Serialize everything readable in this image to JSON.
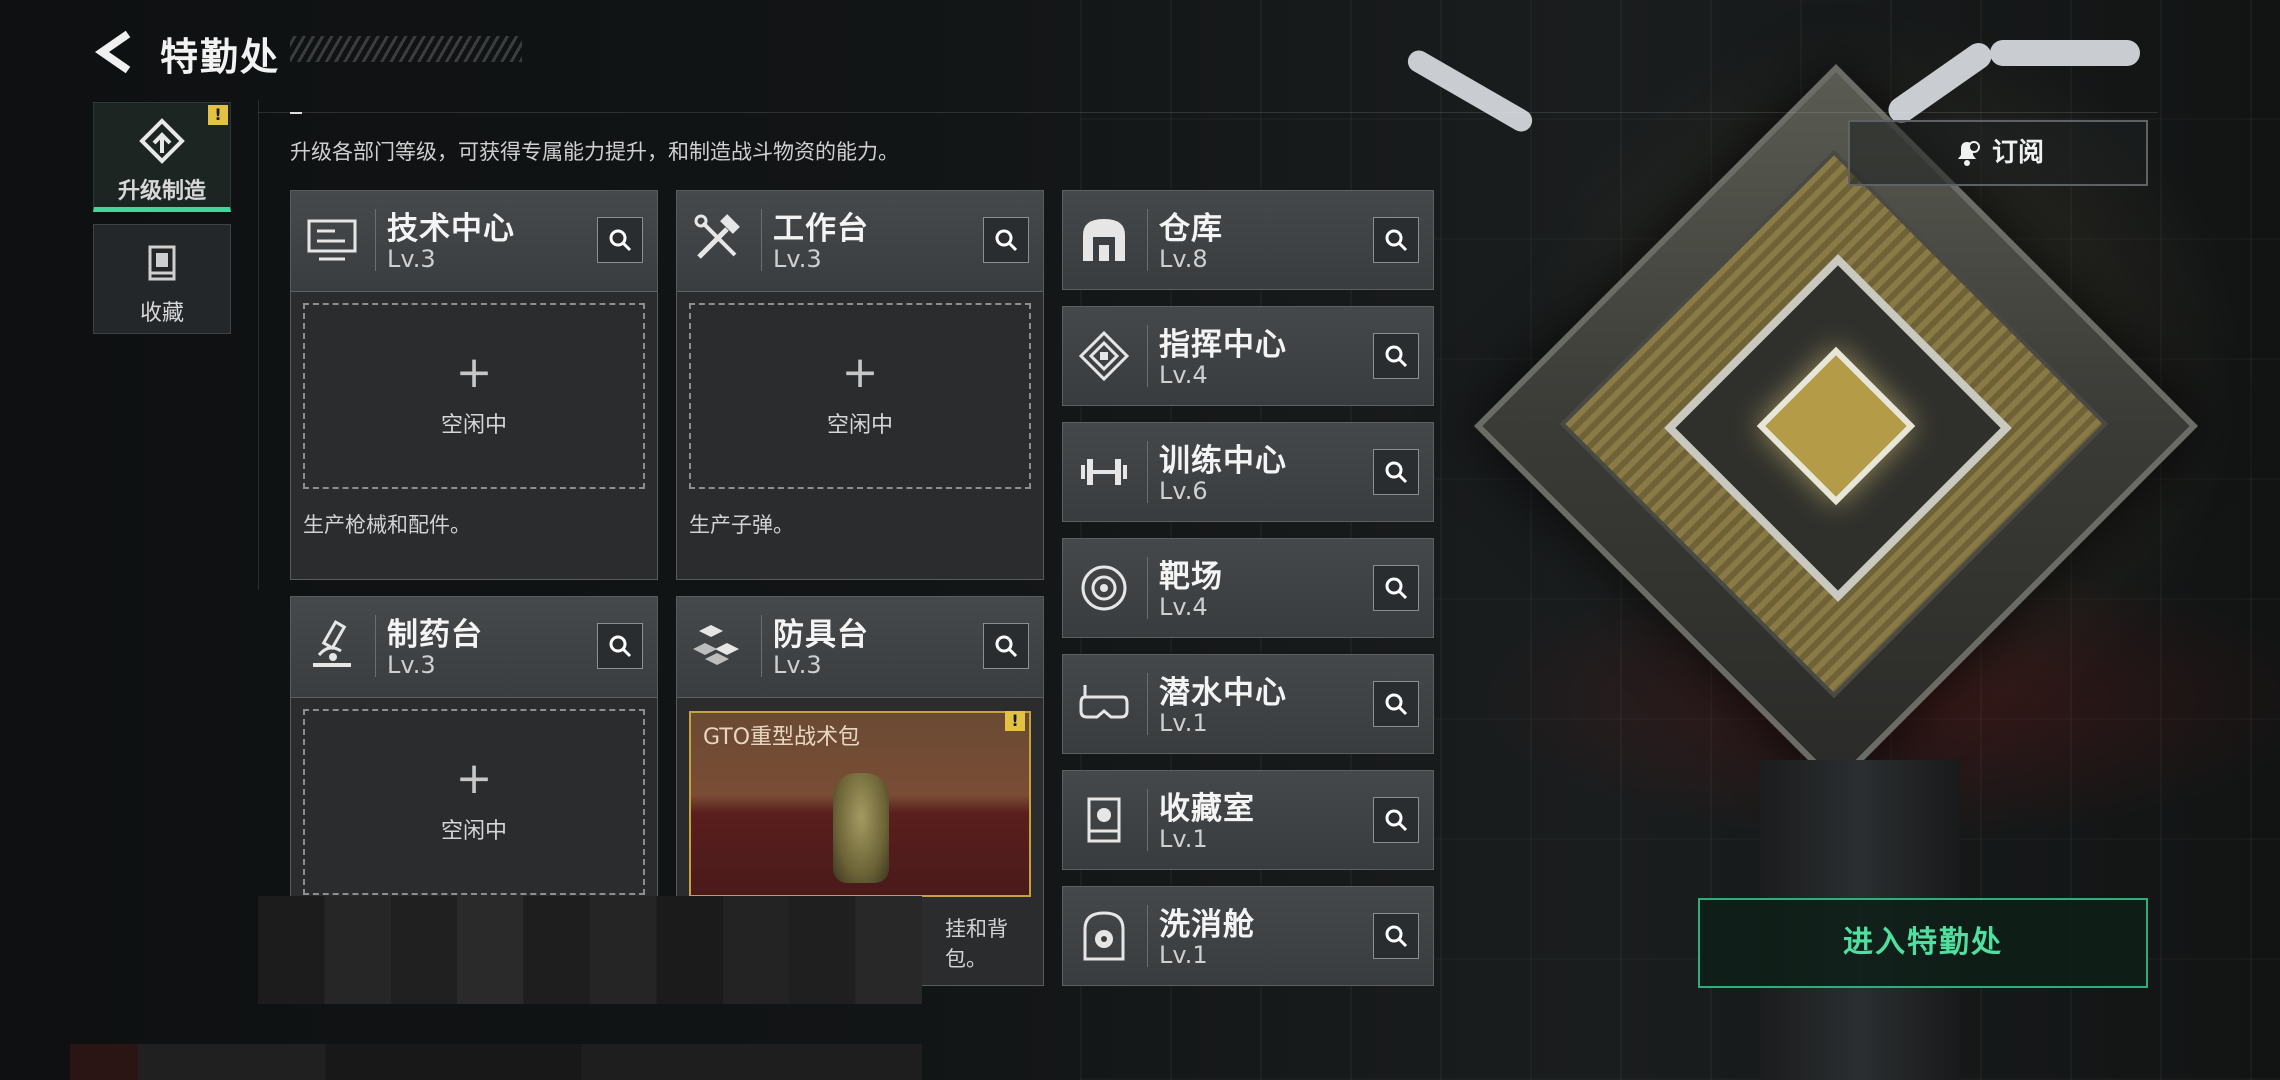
{
  "header": {
    "title": "特勤处",
    "description": "升级各部门等级，可获得专属能力提升，和制造战斗物资的能力。"
  },
  "side_tabs": [
    {
      "label": "升级制造",
      "active": true,
      "badge": "!"
    },
    {
      "label": "收藏",
      "active": false
    }
  ],
  "cards": [
    {
      "name": "技术中心",
      "level": "Lv.3",
      "icon": "monitor-icon",
      "slot_plus": "+",
      "slot_status": "空闲中",
      "desc": "生产枪械和配件。"
    },
    {
      "name": "工作台",
      "level": "Lv.3",
      "icon": "tools-icon",
      "slot_plus": "+",
      "slot_status": "空闲中",
      "desc": "生产子弹。"
    },
    {
      "name": "制药台",
      "level": "Lv.3",
      "icon": "microscope-icon",
      "slot_plus": "+",
      "slot_status": "空闲中"
    },
    {
      "name": "防具台",
      "level": "Lv.3",
      "icon": "armor-icon",
      "item_name": "GTO重型战术包",
      "item_badge": "!",
      "desc_partial": "挂和背包。"
    }
  ],
  "rooms": [
    {
      "name": "仓库",
      "level": "Lv.8",
      "icon": "warehouse-icon"
    },
    {
      "name": "指挥中心",
      "level": "Lv.4",
      "icon": "chip-icon"
    },
    {
      "name": "训练中心",
      "level": "Lv.6",
      "icon": "dumbbell-icon"
    },
    {
      "name": "靶场",
      "level": "Lv.4",
      "icon": "target-icon"
    },
    {
      "name": "潜水中心",
      "level": "Lv.1",
      "icon": "diving-mask-icon"
    },
    {
      "name": "收藏室",
      "level": "Lv.1",
      "icon": "display-case-icon"
    },
    {
      "name": "洗消舱",
      "level": "Lv.1",
      "icon": "decon-icon"
    }
  ],
  "subscribe": {
    "label": "订阅"
  },
  "enter": {
    "label": "进入特勤处"
  },
  "colors": {
    "accent": "#42d69a",
    "warning": "#e3c142",
    "item_border": "#c7a23c"
  }
}
